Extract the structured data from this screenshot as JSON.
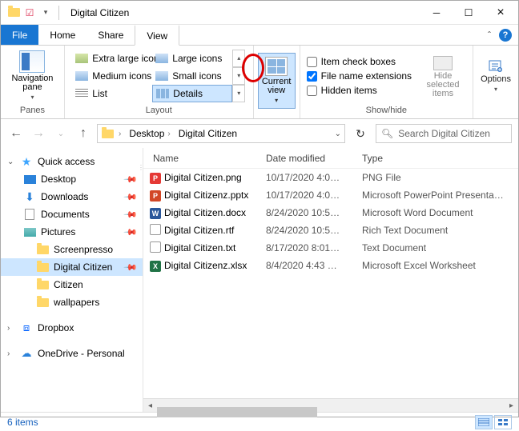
{
  "window": {
    "title": "Digital Citizen"
  },
  "menu": {
    "file": "File",
    "home": "Home",
    "share": "Share",
    "view": "View"
  },
  "ribbon": {
    "panes": {
      "nav_pane": "Navigation pane",
      "label": "Panes"
    },
    "layout": {
      "extra_large": "Extra large icons",
      "large": "Large icons",
      "medium": "Medium icons",
      "small": "Small icons",
      "list": "List",
      "details": "Details",
      "label": "Layout"
    },
    "current_view": {
      "btn": "Current view",
      "label": ""
    },
    "showhide": {
      "item_check": "Item check boxes",
      "file_ext": "File name extensions",
      "hidden": "Hidden items",
      "hide_selected": "Hide selected items",
      "options": "Options",
      "label": "Show/hide"
    }
  },
  "address": {
    "crumbs": [
      "Desktop",
      "Digital Citizen"
    ],
    "search_placeholder": "Search Digital Citizen"
  },
  "sidebar": {
    "quick": "Quick access",
    "items": [
      "Desktop",
      "Downloads",
      "Documents",
      "Pictures",
      "Screenpresso",
      "Digital Citizen",
      "Citizen",
      "wallpapers"
    ],
    "dropbox": "Dropbox",
    "onedrive": "OneDrive - Personal"
  },
  "columns": {
    "name": "Name",
    "date": "Date modified",
    "type": "Type"
  },
  "files": [
    {
      "icon": "png",
      "name": "Digital Citizen.png",
      "date": "10/17/2020 4:0…",
      "type": "PNG File"
    },
    {
      "icon": "ppt",
      "name": "Digital Citizenz.pptx",
      "date": "10/17/2020 4:0…",
      "type": "Microsoft PowerPoint Presenta…"
    },
    {
      "icon": "doc",
      "name": "Digital Citizen.docx",
      "date": "8/24/2020 10:5…",
      "type": "Microsoft Word Document"
    },
    {
      "icon": "rtf",
      "name": "Digital Citizen.rtf",
      "date": "8/24/2020 10:5…",
      "type": "Rich Text Document"
    },
    {
      "icon": "txt",
      "name": "Digital Citizen.txt",
      "date": "8/17/2020 8:01…",
      "type": "Text Document"
    },
    {
      "icon": "xls",
      "name": "Digital Citizenz.xlsx",
      "date": "8/4/2020 4:43 …",
      "type": "Microsoft Excel Worksheet"
    }
  ],
  "status": {
    "count": "6 items"
  }
}
